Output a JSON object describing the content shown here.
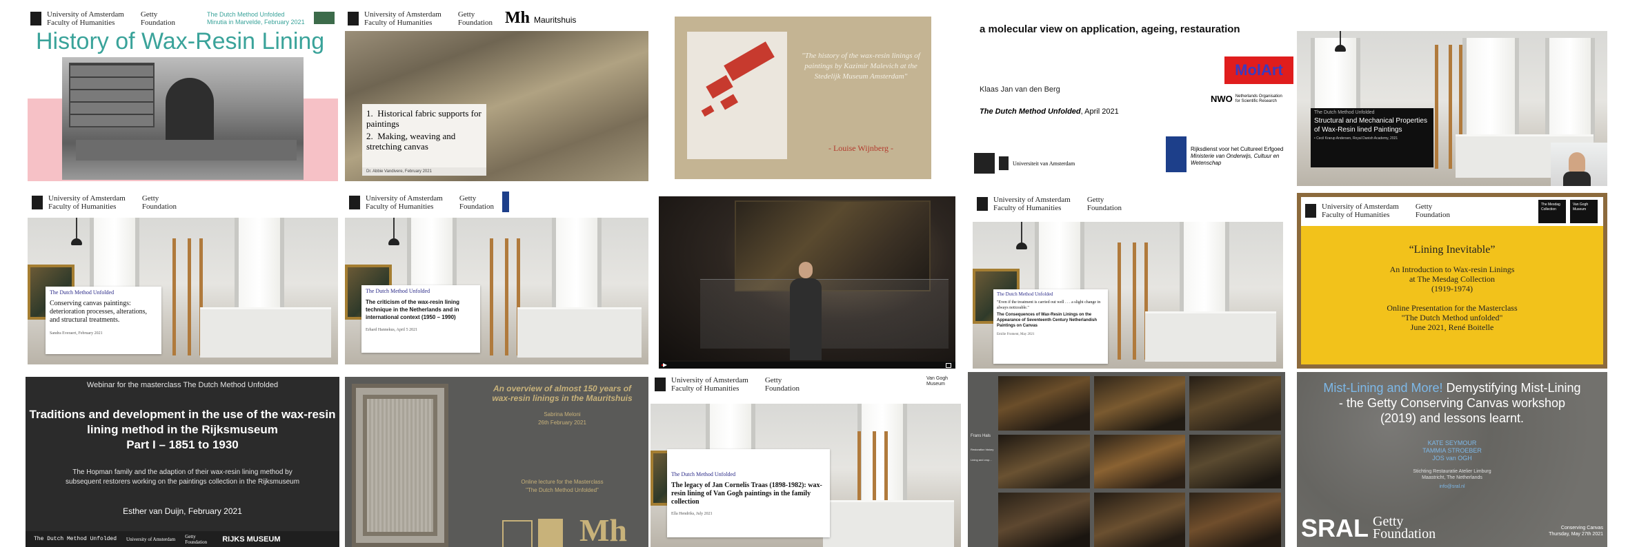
{
  "tiles": {
    "t1": {
      "header_left": "University of Amsterdam",
      "header_sub": "Faculty of Humanities",
      "getty": "Getty Foundation",
      "header_right": "The Dutch Method Unfolded",
      "header_right2": "Minutia in Marvelde, February 2021",
      "title": "History of Wax-Resin Lining"
    },
    "t2": {
      "header_left": "University of Amsterdam",
      "header_sub": "Faculty of Humanities",
      "getty": "Getty Foundation",
      "logo": "Mh",
      "logo_text": "Mauritshuis",
      "item1": "Historical fabric supports for paintings",
      "item2": "Making, weaving and stretching canvas",
      "author": "Dr. Abbie Vandivere, February 2021"
    },
    "t3": {
      "quote": "\"The history of the wax-resin linings of paintings by Kazimir Malevich at the Stedelijk Museum Amsterdam\"",
      "author": "- Louise Wijnberg -"
    },
    "t4": {
      "headline": "a molecular view on application, ageing, restauration",
      "name": "Klaas Jan van den Berg",
      "nwo": "Netherlands Organisation for Scientific Research",
      "event": "The Dutch Method Unfolded",
      "event_date": ", April 2021",
      "uva": "Universiteit van Amsterdam",
      "rce": "Rijksdienst voor het Cultureel Erfgoed",
      "rce2": "Ministerie van Onderwijs, Cultuur en Wetenschap",
      "molart": "MolArt"
    },
    "t5": {
      "kicker": "The Dutch Method Unfolded",
      "title": "Structural and Mechanical Properties of Wax-Resin lined Paintings",
      "author": "Cecil Krarup Andersen, Royal Danish Academy, 2021"
    },
    "t6": {
      "header_left": "University of Amsterdam",
      "header_sub": "Faculty of Humanities",
      "getty": "Getty Foundation",
      "kicker": "The Dutch Method Unfolded",
      "title": "Conserving canvas paintings: deterioration processes, alterations, and structural treatments.",
      "author": "Sandra Everaert, February 2021"
    },
    "t7": {
      "header_left": "University of Amsterdam",
      "header_sub": "Faculty of Humanities",
      "getty": "Getty Foundation",
      "kicker": "The Dutch Method Unfolded",
      "title": "The criticism of the wax-resin lining technique in the Netherlands and in international context (1950 – 1990)",
      "author": "Erhard Hannekus, April 5 2021"
    },
    "t9": {
      "header_left": "University of Amsterdam",
      "header_sub": "Faculty of Humanities",
      "getty": "Getty Foundation",
      "kicker": "The Dutch Method Unfolded",
      "quote": "\"Even if the treatment is carried out well . . . a slight change in always noticeable.\"",
      "title": "The Consequences of Wax-Resin Linings on the Appearance of Seventeenth Century Netherlandish Paintings on Canvas",
      "author": "Emilie Froment, May 2021"
    },
    "t10": {
      "header_left": "University of Amsterdam",
      "header_sub": "Faculty of Humanities",
      "getty": "Getty Foundation",
      "mesdag": "The Mesdag Collection",
      "vgm": "Van Gogh Museum",
      "title": "“Lining Inevitable”",
      "sub1": "An Introduction to Wax-resin Linings",
      "sub2": "at The Mesdag Collection",
      "sub3": "(1919-1974)",
      "sub4": "Online Presentation for the Masterclass",
      "sub5": "\"The Dutch Method unfolded\"",
      "sub6": "June 2021, René Boitelle"
    },
    "t11": {
      "top": "Webinar for the masterclass The Dutch Method Unfolded",
      "title1": "Traditions and development in the use of the wax-resin",
      "title2": "lining method in the Rijksmuseum",
      "title3": "Part I – 1851 to 1930",
      "desc1": "The Hopman family and the adaption of their wax-resin lining method by",
      "desc2": "subsequent restorers working on the paintings collection in the Rijksmuseum",
      "author": "Esther van Duijn, February 2021",
      "foot1": "The Dutch Method Unfolded",
      "foot2": "University of Amsterdam",
      "foot3": "Getty Foundation",
      "foot4": "RIJKS MUSEUM"
    },
    "t12": {
      "title": "An overview of almost 150 years of wax-resin linings in the Mauritshuis",
      "name": "Sabrina Meloni",
      "date": "26th February 2021",
      "lecture": "Online lecture for the Masterclass",
      "lecture2": "\"The Dutch Method Unfolded\"",
      "logo": "Mh"
    },
    "t13": {
      "header_left": "University of Amsterdam",
      "header_sub": "Faculty of Humanities",
      "getty": "Getty Foundation",
      "vgm": "Van Gogh Museum",
      "kicker": "The Dutch Method Unfolded",
      "title": "The legacy of Jan Cornelis Traas (1898-1982): wax-resin lining of Van Gogh paintings in the family collection",
      "author": "Ella Hendriks, July 2021"
    },
    "t14": {
      "label": "Frans Hals",
      "line1": "Restoration history",
      "line2": "Lining and crop..."
    },
    "t15": {
      "title_a": "Mist-Lining and More!",
      "title_b": " Demystifying Mist-Lining",
      "title2": "- the Getty Conserving Canvas workshop",
      "title3": "(2019) and lessons learnt.",
      "names1": "KATE SEYMOUR",
      "names2": "TAMMIA STROEBER",
      "names3": "JOS van OGH",
      "org1": "Stichting Restauratie Atelier Limburg",
      "org2": "Maastricht, The Netherlands",
      "email": "info@sral.nl",
      "sral": "SRAL",
      "getty": "Getty Foundation",
      "foot1": "Conserving Canvas",
      "foot2": "Thursday, May 27th 2021"
    }
  },
  "colors": {
    "teal": "#3aa39a",
    "pink": "#f6c1c6",
    "dark": "#2b2b2b",
    "gold": "#f2c21b",
    "gray": "#5a5a58",
    "light_blue": "#7db8e8",
    "red": "#c0392b"
  }
}
